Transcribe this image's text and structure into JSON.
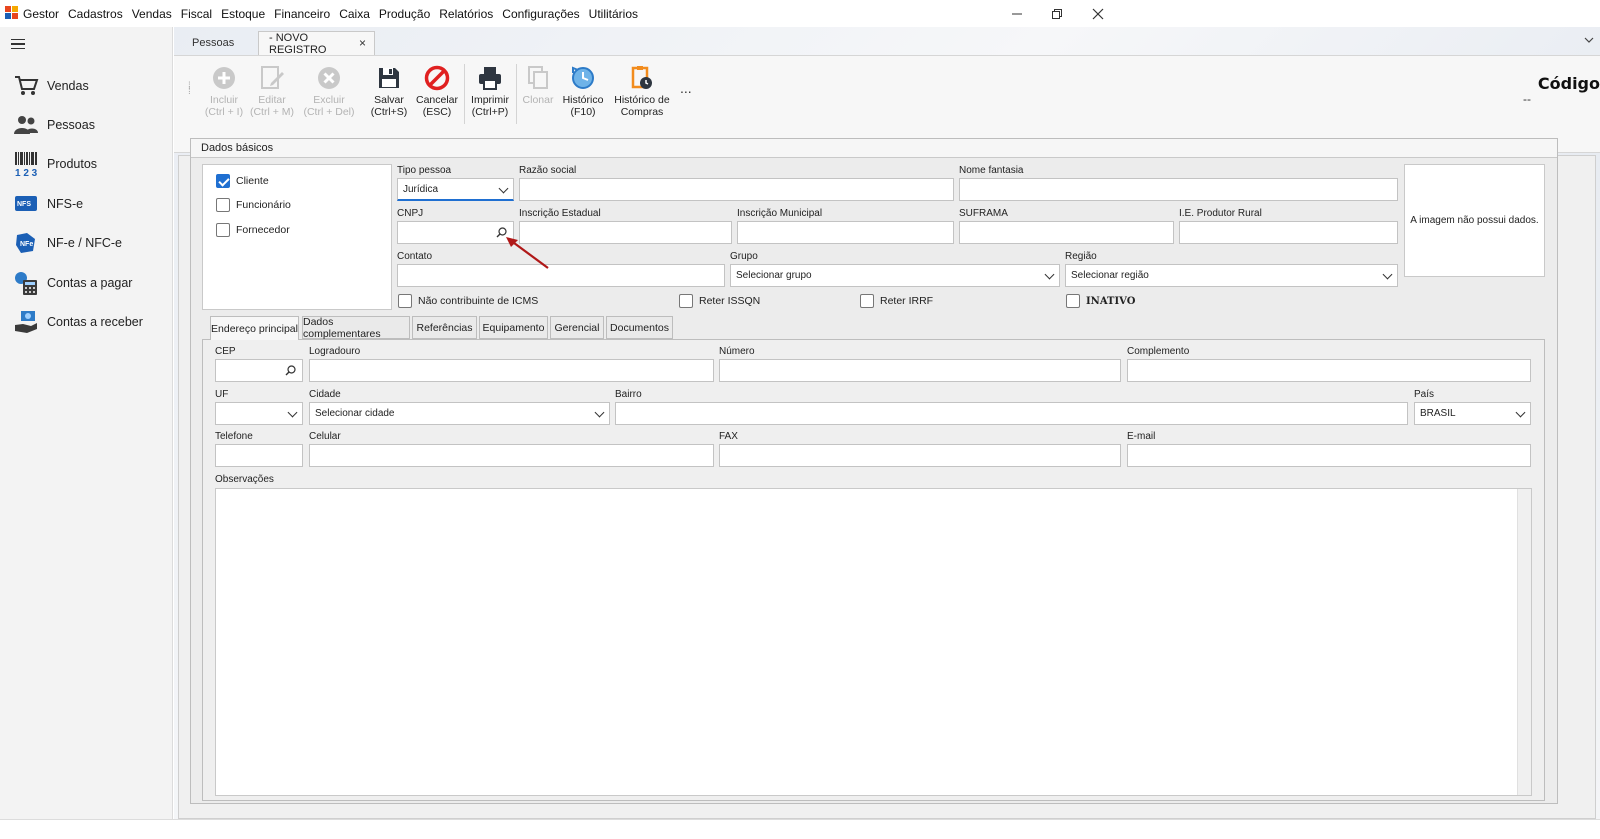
{
  "menu": {
    "items": [
      "Gestor",
      "Cadastros",
      "Vendas",
      "Fiscal",
      "Estoque",
      "Financeiro",
      "Caixa",
      "Produção",
      "Relatórios",
      "Configurações",
      "Utilitários"
    ],
    "window_controls": [
      "minimize-icon",
      "restore-icon",
      "close-icon"
    ]
  },
  "sidebar": {
    "items": [
      {
        "label": "Vendas",
        "icon": "cart-icon"
      },
      {
        "label": "Pessoas",
        "icon": "people-icon"
      },
      {
        "label": "Produtos",
        "icon": "barcode-icon"
      },
      {
        "label": "NFS-e",
        "icon": "nfse-icon"
      },
      {
        "label": "NF-e / NFC-e",
        "icon": "nfe-icon"
      },
      {
        "label": "Contas a pagar",
        "icon": "calculator-icon"
      },
      {
        "label": "Contas a receber",
        "icon": "money-hand-icon"
      }
    ]
  },
  "tabs": {
    "pessoas": "Pessoas",
    "novo": "- NOVO REGISTRO",
    "close": "×"
  },
  "toolbar": {
    "incluir": {
      "l1": "Incluir",
      "l2": "(Ctrl + I)"
    },
    "editar": {
      "l1": "Editar",
      "l2": "(Ctrl + M)"
    },
    "excluir": {
      "l1": "Excluir",
      "l2": "(Ctrl + Del)"
    },
    "salvar": {
      "l1": "Salvar",
      "l2": "(Ctrl+S)"
    },
    "cancelar": {
      "l1": "Cancelar",
      "l2": "(ESC)"
    },
    "imprimir": {
      "l1": "Imprimir",
      "l2": "(Ctrl+P)"
    },
    "clonar": {
      "l1": "Clonar",
      "l2": ""
    },
    "historico": {
      "l1": "Histórico",
      "l2": "(F10)"
    },
    "historico_compras": {
      "l1": "Histórico de",
      "l2": "Compras"
    },
    "more": "...",
    "codigo_label": "Código",
    "codigo_value": "--"
  },
  "dados_basicos": {
    "title": "Dados básicos",
    "roles": [
      {
        "label": "Cliente",
        "checked": true
      },
      {
        "label": "Funcionário",
        "checked": false
      },
      {
        "label": "Fornecedor",
        "checked": false
      }
    ],
    "tipo_pessoa_label": "Tipo pessoa",
    "tipo_pessoa_value": "Jurídica",
    "razao_social_label": "Razão social",
    "nome_fantasia_label": "Nome fantasia",
    "cnpj_label": "CNPJ",
    "inscricao_estadual_label": "Inscrição Estadual",
    "inscricao_municipal_label": "Inscrição Municipal",
    "suframa_label": "SUFRAMA",
    "ie_produtor_label": "I.E. Produtor Rural",
    "contato_label": "Contato",
    "grupo_label": "Grupo",
    "grupo_value": "Selecionar grupo",
    "regiao_label": "Região",
    "regiao_value": "Selecionar região",
    "image_text": "A imagem não possui dados.",
    "nao_contribuinte": "Não contribuinte de ICMS",
    "reter_issqn": "Reter ISSQN",
    "reter_irrf": "Reter IRRF",
    "inativo": "INATIVO"
  },
  "address_tabs": [
    "Endereço principal",
    "Dados complementares",
    "Referências",
    "Equipamento",
    "Gerencial",
    "Documentos"
  ],
  "endereco": {
    "cep_label": "CEP",
    "logradouro_label": "Logradouro",
    "numero_label": "Número",
    "complemento_label": "Complemento",
    "uf_label": "UF",
    "cidade_label": "Cidade",
    "cidade_value": "Selecionar cidade",
    "bairro_label": "Bairro",
    "pais_label": "País",
    "pais_value": "BRASIL",
    "telefone_label": "Telefone",
    "celular_label": "Celular",
    "fax_label": "FAX",
    "email_label": "E-mail",
    "observacoes_label": "Observações"
  },
  "colors": {
    "accent": "#1f6fd1",
    "cancel_red": "#e02020",
    "annotation_arrow": "#b01818"
  }
}
